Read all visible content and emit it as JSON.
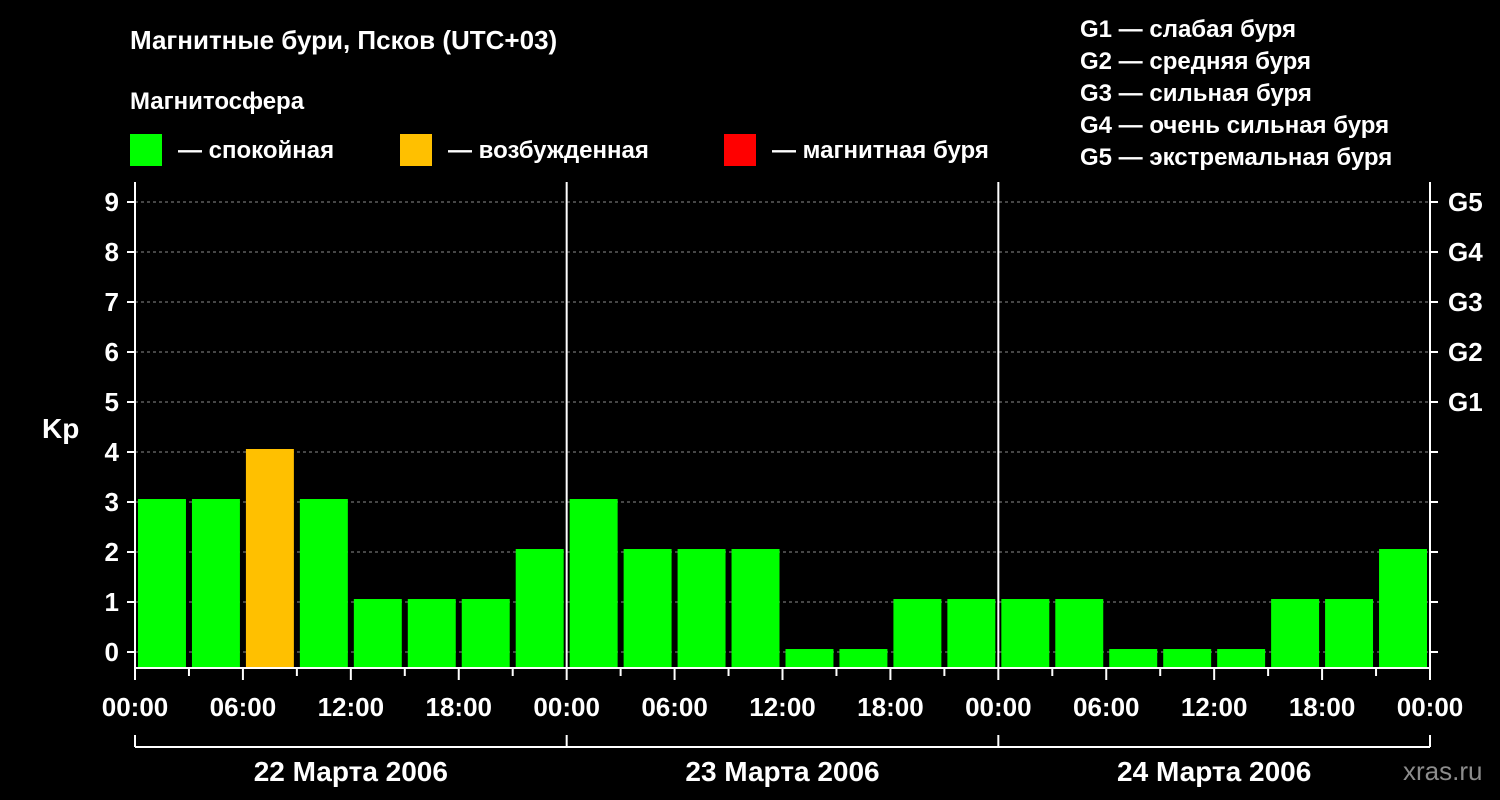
{
  "title": "Магнитные бури, Псков (UTC+03)",
  "subtitle": "Магнитосфера",
  "legend": [
    {
      "label": "— спокойная",
      "color": "#00ff00"
    },
    {
      "label": "— возбужденная",
      "color": "#ffc000"
    },
    {
      "label": "— магнитная буря",
      "color": "#ff0000"
    }
  ],
  "storm_levels": [
    "G1 — слабая буря",
    "G2 — средняя буря",
    "G3 — сильная буря",
    "G4 — очень сильная буря",
    "G5 — экстремальная буря"
  ],
  "watermark": "xras.ru",
  "colors": {
    "background": "#000000",
    "quiet": "#00ff00",
    "active": "#ffc000",
    "storm": "#ff0000",
    "grid": "#8c8c8c",
    "axis": "#ffffff"
  },
  "chart_data": {
    "type": "bar",
    "ylabel": "Kp",
    "ylim": [
      0,
      9
    ],
    "yticks": [
      "0",
      "1",
      "2",
      "3",
      "4",
      "5",
      "6",
      "7",
      "8",
      "9"
    ],
    "right_ticks": [
      {
        "value": 5,
        "label": "G1"
      },
      {
        "value": 6,
        "label": "G2"
      },
      {
        "value": 7,
        "label": "G3"
      },
      {
        "value": 8,
        "label": "G4"
      },
      {
        "value": 9,
        "label": "G5"
      }
    ],
    "grid": true,
    "xtick_labels": [
      "00:00",
      "06:00",
      "12:00",
      "18:00",
      "00:00",
      "06:00",
      "12:00",
      "18:00",
      "00:00",
      "06:00",
      "12:00",
      "18:00",
      "00:00"
    ],
    "days": [
      "22 Марта 2006",
      "23 Марта 2006",
      "24 Марта 2006"
    ],
    "interval_hours": 3,
    "values": [
      3,
      3,
      4,
      3,
      1,
      1,
      1,
      2,
      3,
      2,
      2,
      2,
      0,
      0,
      1,
      1,
      1,
      1,
      0,
      0,
      0,
      1,
      1,
      2
    ],
    "bar_status": [
      "quiet",
      "quiet",
      "active",
      "quiet",
      "quiet",
      "quiet",
      "quiet",
      "quiet",
      "quiet",
      "quiet",
      "quiet",
      "quiet",
      "quiet",
      "quiet",
      "quiet",
      "quiet",
      "quiet",
      "quiet",
      "quiet",
      "quiet",
      "quiet",
      "quiet",
      "quiet",
      "quiet"
    ]
  }
}
